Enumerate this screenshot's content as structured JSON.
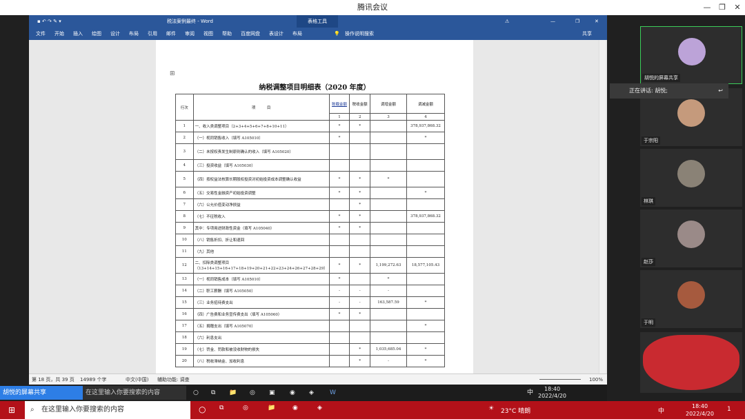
{
  "meeting": {
    "title": "腾讯会议",
    "btn_min": "—",
    "btn_restore": "❐",
    "btn_close": "✕"
  },
  "word": {
    "title": "税法案例最终 - Word",
    "table_tools": "表格工具",
    "ribbon": [
      "文件",
      "开始",
      "插入",
      "绘图",
      "设计",
      "布局",
      "引用",
      "邮件",
      "审阅",
      "视图",
      "帮助",
      "百度网盘",
      "表设计",
      "布局"
    ],
    "search": "操作说明搜索",
    "share": "共享",
    "status_page": "第 18 页，共 39 页",
    "status_words": "14989 个字",
    "status_lang": "中文(中国)",
    "status_access": "辅助功能: 调查",
    "zoom": "100%"
  },
  "doc": {
    "title": "纳税调整项目明细表（2020 年度）",
    "headers": [
      "行次",
      "项　　　目",
      "账载金额",
      "税收金额",
      "调增金额",
      "调减金额"
    ],
    "subheaders": [
      "1",
      "2",
      "3",
      "4"
    ],
    "rows": [
      [
        "1",
        "一、收入类调整项目（2+3+4+5+6+7+8+10+11）",
        "*",
        "*",
        "",
        "378,937,868.32"
      ],
      [
        "2",
        "（一）视同销售收入（填写 A105010）",
        "*",
        "",
        "",
        "*"
      ],
      [
        "3",
        "（二）未按权责发生制原则确认的收入（填写 A105020）",
        "",
        "",
        "",
        ""
      ],
      [
        "4",
        "（三）投资收益（填写 A105030）",
        "",
        "",
        "",
        ""
      ],
      [
        "5",
        "（四）按权益法核算长期股权投资对初始投资成本调整确认收益",
        "*",
        "*",
        "*",
        ""
      ],
      [
        "6",
        "（五）交易性金融资产初始投资调整",
        "*",
        "*",
        "",
        "*"
      ],
      [
        "7",
        "（六）公允价值变动净损益",
        "",
        "*",
        "",
        ""
      ],
      [
        "8",
        "（七）不征税收入",
        "*",
        "*",
        "",
        "378,937,868.32"
      ],
      [
        "9",
        "其中：专项用途财政性资金（填写 A105040）",
        "*",
        "*",
        "",
        ""
      ],
      [
        "10",
        "（八）销售折扣、折让和退回",
        "",
        "",
        "",
        ""
      ],
      [
        "11",
        "（九）其他",
        "",
        "",
        "",
        ""
      ],
      [
        "12",
        "二、扣除类调整项目（13+14+15+16+17+18+19+20+21+22+23+24+26+27+28+29）",
        "*",
        "*",
        "1,199,272.63",
        "18,577,105.43"
      ],
      [
        "13",
        "（一）视同销售成本（填写 A105010）",
        "*",
        "",
        "*",
        ""
      ],
      [
        "14",
        "（二）职工薪酬（填写 A105050）",
        "-",
        "-",
        "-",
        ""
      ],
      [
        "15",
        "（三）业务招待费支出",
        "-",
        "-",
        "163,587.59",
        "*"
      ],
      [
        "16",
        "（四）广告费和业务宣传费支出（填写 A105060）",
        "*",
        "*",
        "",
        ""
      ],
      [
        "17",
        "（五）捐赠支出（填写 A105070）",
        "",
        "",
        "",
        "*"
      ],
      [
        "18",
        "（六）利息支出",
        "",
        "",
        "",
        ""
      ],
      [
        "19",
        "（七）罚金、罚款和被没收财物的损失",
        "",
        "*",
        "1,035,685.04",
        "*"
      ],
      [
        "20",
        "（八）税收滞纳金、加收利息",
        "",
        "*",
        "-",
        "*"
      ]
    ]
  },
  "participants": [
    {
      "name": "胡悦的屏幕共享",
      "sharing": true,
      "color": "#bca3d8"
    },
    {
      "name": "于宗阳",
      "color": "#c59a7c"
    },
    {
      "name": "林琪",
      "color": "#8a8276"
    },
    {
      "name": "赵莎",
      "color": "#9a8a88"
    },
    {
      "name": "于明",
      "color": "#a65a3e"
    },
    {
      "name": "",
      "color": "#c92a30"
    }
  ],
  "speaking": {
    "label": "正在讲话: 胡悦;"
  },
  "meeting_bar": {
    "share_label": "胡悦的屏幕共享",
    "search_hint": "在这里输入你要搜索的内容",
    "time": "18:40",
    "date": "2022/4/20",
    "ime": "中"
  },
  "taskbar": {
    "search_hint": "在这里输入你要搜索的内容",
    "weather": "23°C 晴朗",
    "ime": "中",
    "time": "18:40",
    "date": "2022/4/20",
    "notify": "1"
  }
}
